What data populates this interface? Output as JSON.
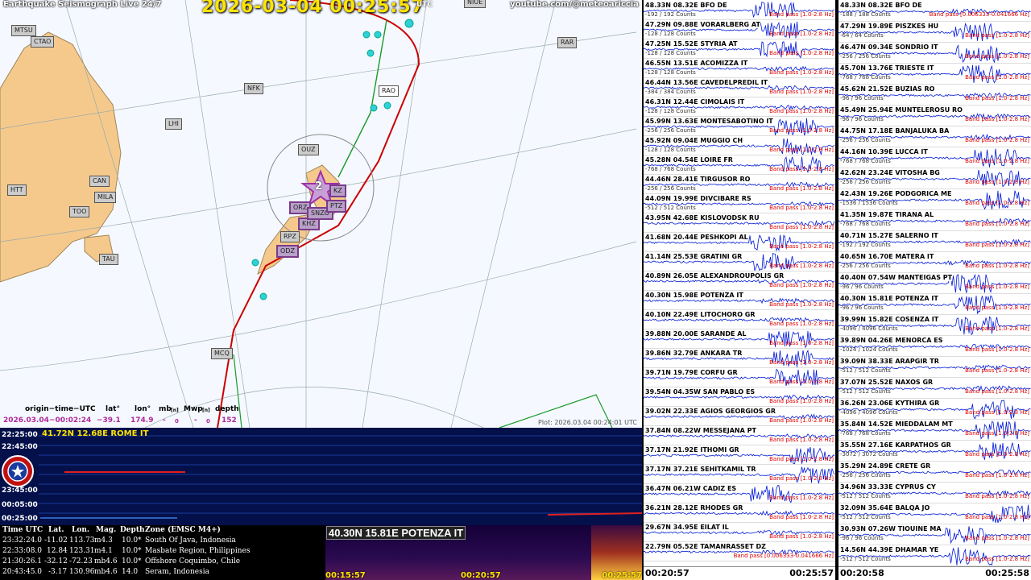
{
  "header": {
    "left_title": "Earthquake Seismograph Live 24/7",
    "datetime": "2026-03-04  00:25:57",
    "utc": "UTC",
    "channel": "youtube.com/@meteoariccia"
  },
  "map": {
    "stations": [
      {
        "code": "MTSU"
      },
      {
        "code": "CTAO"
      },
      {
        "code": "NIUE"
      },
      {
        "code": "RAR"
      },
      {
        "code": "RAO"
      },
      {
        "code": "NFK"
      },
      {
        "code": "LHI"
      },
      {
        "code": "OUZ"
      },
      {
        "code": "CAN"
      },
      {
        "code": "HTT"
      },
      {
        "code": "MILA"
      },
      {
        "code": "TOO"
      },
      {
        "code": "TAU"
      },
      {
        "code": "RPZ"
      },
      {
        "code": "ODZ"
      },
      {
        "code": "MCQ"
      },
      {
        "code": "KHZ"
      },
      {
        "code": "ORZ"
      },
      {
        "code": "SNZO"
      },
      {
        "code": "PTZ"
      },
      {
        "code": "KZ"
      }
    ],
    "event_marker": "2",
    "origin_headers": [
      "origin−time−UTC",
      "lat°",
      "lon°",
      "mb",
      "[n]",
      "Mwp",
      "[n]",
      "depth"
    ],
    "origin_values": {
      "time": "2026.03.04−00:02:24",
      "lat": "−39.1",
      "lon": "174.9",
      "mb": "-",
      "mb_n": "0",
      "mwp": "-",
      "mwp_n": "0",
      "depth": "152"
    },
    "plot_label": "Plot: 2026.03.04  00:24:01  UTC"
  },
  "helicorder": {
    "title": "41.72N 12.68E ROME IT",
    "times": [
      "22:25:00",
      "22:45:00",
      "23:45:00",
      "00:05:00",
      "00:25:00"
    ]
  },
  "quakes": {
    "headers": [
      "Time UTC",
      "Lat.",
      "Lon.",
      "Mag.",
      "Depth",
      "Zone (EMSC M4+)"
    ],
    "rows": [
      [
        "23:32:24.0",
        "-11.02",
        "113.73",
        "m4.3",
        "10.0*",
        "South Of Java, Indonesia"
      ],
      [
        "22:33:08.0",
        "12.84",
        "123.31",
        "m4.1",
        "10.0*",
        "Masbate Region, Philippines"
      ],
      [
        "21:30:26.1",
        "-32.12",
        "-72.23",
        "mb4.6",
        "10.0*",
        "Offshore Coquimbo, Chile"
      ],
      [
        "20:43:45.0",
        "-3.17",
        "130.96",
        "mb4.6",
        "14.0",
        "Seram, Indonesia"
      ]
    ]
  },
  "spectrogram": {
    "station": "40.30N 15.81E POTENZA IT",
    "ticks": [
      "00:15:57",
      "00:20:57",
      "00:25:57"
    ]
  },
  "seismo_left": {
    "traces": [
      {
        "name": "48.33N 08.32E BFO DE",
        "counts": "-192 / 192 Counts",
        "band": "Band pass [1.0-2.8 Hz]"
      },
      {
        "name": "47.29N 09.88E VORARLBERG AT",
        "counts": "-128 / 128 Counts",
        "band": "Band pass [1.0-2.8 Hz]"
      },
      {
        "name": "47.25N 15.52E STYRIA AT",
        "counts": "-128 / 128 Counts",
        "band": "Band pass [1.0-2.8 Hz]"
      },
      {
        "name": "46.55N 13.51E ACOMIZZA IT",
        "counts": "-128 / 128 Counts",
        "band": "Band pass [1.0-2.8 Hz]"
      },
      {
        "name": "46.44N 13.56E CAVEDELPREDIL IT",
        "counts": "-384 / 384 Counts",
        "band": "Band pass [1.0-2.8 Hz]"
      },
      {
        "name": "46.31N 12.44E CIMOLAIS IT",
        "counts": "-128 / 128 Counts",
        "band": "Band pass [1.0-2.8 Hz]"
      },
      {
        "name": "45.99N 13.63E MONTESABOTINO IT",
        "counts": "-256 / 256 Counts",
        "band": "Band pass [1.0-2.8 Hz]"
      },
      {
        "name": "45.92N 09.04E MUGGIO CH",
        "counts": "-128 / 128 Counts",
        "band": "Band pass [1.0-2.8 Hz]"
      },
      {
        "name": "45.28N 04.54E LOIRE FR",
        "counts": "-768 / 768 Counts",
        "band": "Band pass [1.0-2.8 Hz]"
      },
      {
        "name": "44.46N 28.41E TIRGUSOR RO",
        "counts": "-256 / 256 Counts",
        "band": "Band pass [1.0-2.8 Hz]"
      },
      {
        "name": "44.09N 19.99E DIVCIBARE RS",
        "counts": "-512 / 512 Counts",
        "band": "Band pass [1.0-2.8 Hz]"
      },
      {
        "name": "43.95N 42.68E KISLOVODSK RU",
        "counts": "",
        "band": "Band pass [1.0-2.8 Hz]"
      },
      {
        "name": "41.68N 20.44E PESHKOPI AL",
        "counts": "",
        "band": "Band pass [1.0-2.8 Hz]"
      },
      {
        "name": "41.14N 25.53E GRATINI GR",
        "counts": "",
        "band": "Band pass [1.0-2.8 Hz]"
      },
      {
        "name": "40.89N 26.05E ALEXANDROUPOLIS GR",
        "counts": "",
        "band": "Band pass [1.0-2.8 Hz]"
      },
      {
        "name": "40.30N 15.98E POTENZA IT",
        "counts": "",
        "band": "Band pass [1.0-2.8 Hz]"
      },
      {
        "name": "40.10N 22.49E LITOCHORO GR",
        "counts": "",
        "band": "Band pass [1.0-2.8 Hz]"
      },
      {
        "name": "39.88N 20.00E SARANDE AL",
        "counts": "",
        "band": "Band pass [1.0-2.8 Hz]"
      },
      {
        "name": "39.86N 32.79E ANKARA TR",
        "counts": "",
        "band": "Band pass [1.0-2.8 Hz]"
      },
      {
        "name": "39.71N 19.79E CORFU GR",
        "counts": "",
        "band": "Band pass [1.0-2.8 Hz]"
      },
      {
        "name": "39.54N 04.35W SAN PABLO ES",
        "counts": "",
        "band": "Band pass [1.0-2.8 Hz]"
      },
      {
        "name": "39.02N 22.33E AGIOS GEORGIOS GR",
        "counts": "",
        "band": "Band pass [1.0-2.8 Hz]"
      },
      {
        "name": "37.84N 08.22W MESSEJANA PT",
        "counts": "",
        "band": "Band pass [1.0-2.8 Hz]"
      },
      {
        "name": "37.17N 21.92E ITHOMI GR",
        "counts": "",
        "band": "Band pass [1.0-2.8 Hz]"
      },
      {
        "name": "37.17N 37.21E SEHITKAMIL TR",
        "counts": "",
        "band": "Band pass [1.0-2.8 Hz]"
      },
      {
        "name": "36.47N 06.21W CADIZ ES",
        "counts": "",
        "band": "Band pass [1.0-2.8 Hz]"
      },
      {
        "name": "36.21N 28.12E RHODES GR",
        "counts": "",
        "band": "Band pass [1.0-2.8 Hz]"
      },
      {
        "name": "29.67N 34.95E EILAT IL",
        "counts": "",
        "band": "Band pass [1.0-2.8 Hz]"
      },
      {
        "name": "22.79N 05.52E TAMANRASSET DZ",
        "counts": "",
        "band": "Band pass [0.006333-0.041666 Hz]"
      }
    ],
    "foot_left": "00:20:57",
    "foot_right": "00:25:57"
  },
  "seismo_right": {
    "traces": [
      {
        "name": "48.33N 08.32E BFO DE",
        "counts": "-188 / 188 Counts",
        "band": "Band pass [0.006333-0.041666 Hz]"
      },
      {
        "name": "47.29N 19.89E PISZKES HU",
        "counts": "-64 / 64 Counts",
        "band": "Band pass [1.0-2.8 Hz]"
      },
      {
        "name": "46.47N 09.34E SONDRIO IT",
        "counts": "-256 / 256 Counts",
        "band": "Band pass [1.0-2.8 Hz]"
      },
      {
        "name": "45.70N 13.76E TRIESTE IT",
        "counts": "-768 / 768 Counts",
        "band": "Band pass [1.0-2.8 Hz]"
      },
      {
        "name": "45.62N 21.52E BUZIAS RO",
        "counts": "-96 / 96 Counts",
        "band": "Band pass [1.0-2.8 Hz]"
      },
      {
        "name": "45.49N 25.94E MUNTELEROSU RO",
        "counts": "-96 / 96 Counts",
        "band": "Band pass [1.0-2.8 Hz]"
      },
      {
        "name": "44.75N 17.18E BANJALUKA BA",
        "counts": "-256 / 256 Counts",
        "band": "Band pass [1.0-2.8 Hz]"
      },
      {
        "name": "44.16N 10.39E LUCCA IT",
        "counts": "-768 / 768 Counts",
        "band": "Band pass [1.0-2.8 Hz]"
      },
      {
        "name": "42.62N 23.24E VITOSHA BG",
        "counts": "-256 / 256 Counts",
        "band": "Band pass [1.0-2.8 Hz]"
      },
      {
        "name": "42.43N 19.26E PODGORICA ME",
        "counts": "-1536 / 1536 Counts",
        "band": "Band pass [1.0-2.8 Hz]"
      },
      {
        "name": "41.35N 19.87E TIRANA AL",
        "counts": "-768 / 768 Counts",
        "band": "Band pass [1.0-2.8 Hz]"
      },
      {
        "name": "40.71N 15.27E SALERNO IT",
        "counts": "-192 / 192 Counts",
        "band": "Band pass [1.0-2.8 Hz]"
      },
      {
        "name": "40.65N 16.70E MATERA IT",
        "counts": "-256 / 256 Counts",
        "band": "Band pass [1.0-2.8 Hz]"
      },
      {
        "name": "40.40N 07.54W MANTEIGAS PT",
        "counts": "-96 / 96 Counts",
        "band": "Band pass [1.0-2.8 Hz]"
      },
      {
        "name": "40.30N 15.81E POTENZA IT",
        "counts": "-96 / 96 Counts",
        "band": "Band pass [1.0-2.8 Hz]"
      },
      {
        "name": "39.99N 15.82E COSENZA IT",
        "counts": "-4096 / 4096 Counts",
        "band": "Band pass [1.0-2.8 Hz]"
      },
      {
        "name": "39.89N 04.26E MENORCA ES",
        "counts": "-1024 / 1024 Counts",
        "band": "Band pass [1.0-2.8 Hz]"
      },
      {
        "name": "39.09N 38.33E ARAPGIR TR",
        "counts": "-512 / 512 Counts",
        "band": "Band pass [1.0-2.8 Hz]"
      },
      {
        "name": "37.07N 25.52E NAXOS GR",
        "counts": "-512 / 512 Counts",
        "band": "Band pass [1.0-2.8 Hz]"
      },
      {
        "name": "36.26N 23.06E KYTHIRA GR",
        "counts": "-4096 / 4096 Counts",
        "band": "Band pass [1.0-2.8 Hz]"
      },
      {
        "name": "35.84N 14.52E MIEDDALAM MT",
        "counts": "-768 / 768 Counts",
        "band": "Band pass [1.0-2.8 Hz]"
      },
      {
        "name": "35.55N 27.16E KARPATHOS GR",
        "counts": "-3072 / 3072 Counts",
        "band": "Band pass [1.0-2.8 Hz]"
      },
      {
        "name": "35.29N 24.89E CRETE GR",
        "counts": "-256 / 256 Counts",
        "band": "Band pass [1.0-2.8 Hz]"
      },
      {
        "name": "34.96N 33.33E CYPRUS CY",
        "counts": "-512 / 512 Counts",
        "band": "Band pass [1.0-2.8 Hz]"
      },
      {
        "name": "32.09N 35.64E BALQA JO",
        "counts": "-512 / 512 Counts",
        "band": "Band pass [1.0-2.8 Hz]"
      },
      {
        "name": "30.93N 07.26W TIOUINE MA",
        "counts": "-96 / 96 Counts",
        "band": "Band pass [1.0-2.8 Hz]"
      },
      {
        "name": "14.56N 44.39E DHAMAR YE",
        "counts": "-512 / 512 Counts",
        "band": "Band pass [1.0-2.8 Hz]"
      }
    ],
    "foot_left": "00:20:58",
    "foot_right": "00:25:58"
  },
  "colors": {
    "accent": "#ffe400",
    "trace": "#0018d8",
    "marker": "#b0289a",
    "land": "#f5c98c"
  }
}
